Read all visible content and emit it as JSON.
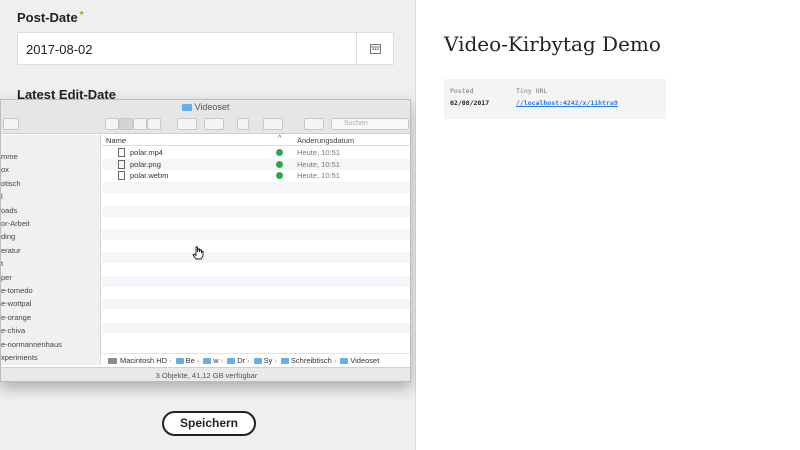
{
  "form": {
    "post_date_label": "Post-Date",
    "post_date_value": "2017-08-02",
    "latest_edit_label": "Latest Edit-Date",
    "save_label": "Speichern"
  },
  "finder": {
    "title": "Videoset",
    "search_placeholder": "Suchen",
    "sidebar_items": [
      "mme",
      "ox",
      "otisch",
      "l",
      "oads",
      "or-Arbeit",
      "ding",
      "eratur",
      "t",
      "per",
      "e-tomedo",
      "e-wottpal",
      "e-orange",
      "e-chiva",
      "e-normannenhaus",
      "xperiments"
    ],
    "columns": {
      "name": "Name",
      "sort_indicator": "^",
      "date": "Änderungsdatum"
    },
    "files": [
      {
        "name": "polar.mp4",
        "date": "Heute, 10:51"
      },
      {
        "name": "polar.png",
        "date": "Heute, 10:51"
      },
      {
        "name": "polar.webm",
        "date": "Heute, 10:51"
      }
    ],
    "path": [
      "Macintosh HD",
      "Be",
      "w",
      "Dr",
      "Sy",
      "Schreibtisch",
      "Videoset"
    ],
    "status": "3 Objekte, 41,12 GB verfügbar"
  },
  "preview": {
    "title": "Video-Kirbytag Demo",
    "posted_label": "Posted",
    "posted_value": "02/08/2017",
    "tiny_url_label": "Tiny URL",
    "tiny_url_value": "//localhost:4242/x/1ihtra9"
  },
  "colors": {
    "accent": "#2a7ae2",
    "folder": "#6aaee8",
    "sync": "#2ea44f"
  }
}
